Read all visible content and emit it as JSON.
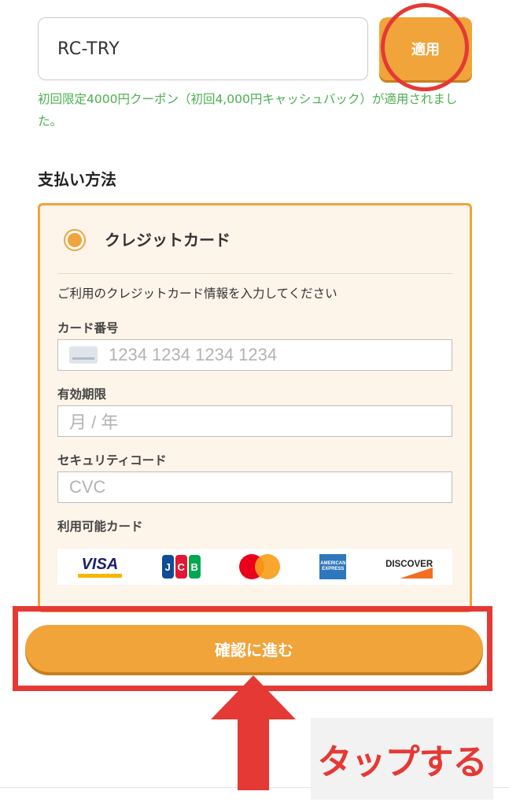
{
  "coupon": {
    "input_value": "RC-TRY",
    "apply_label": "適用",
    "message": "初回限定4000円クーポン（初回4,000円キャッシュバック）が適用されました。"
  },
  "payment": {
    "section_title": "支払い方法",
    "method_label": "クレジットカード",
    "info_text": "ご利用のクレジットカード情報を入力してください",
    "card_number_label": "カード番号",
    "card_number_placeholder": "1234 1234 1234 1234",
    "expiry_label": "有効期限",
    "expiry_placeholder": "月 / 年",
    "cvc_label": "セキュリティコード",
    "cvc_placeholder": "CVC",
    "brands_label": "利用可能カード",
    "brands": {
      "visa": "VISA",
      "jcb": [
        "J",
        "C",
        "B"
      ],
      "amex": "AMERICAN EXPRESS",
      "discover": "DISCOVER"
    }
  },
  "confirm_label": "確認に進む",
  "annotation": {
    "tap_text": "タップする"
  },
  "colors": {
    "accent": "#f0a43a",
    "success": "#4caf50",
    "annotation": "#e53935",
    "panel_bg": "#fdf4ea"
  }
}
